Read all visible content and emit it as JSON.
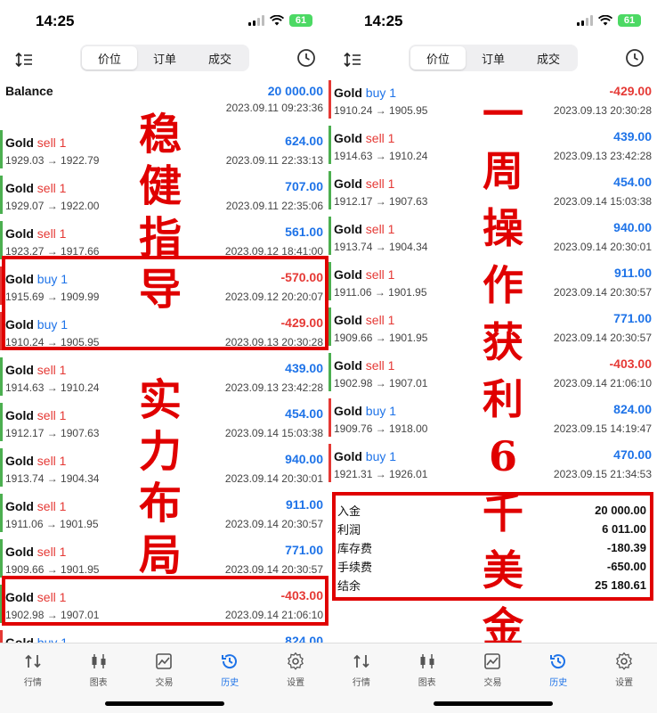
{
  "colors": {
    "profit_positive": "#1e73e8",
    "profit_negative": "#e53935",
    "sell": "#e53935",
    "buy": "#1e73e8",
    "annotation": "#e00000",
    "indicator_sell": "#4caf50",
    "indicator_buy": "#e53935"
  },
  "left": {
    "status": {
      "time": "14:25",
      "battery": "61"
    },
    "toolbar": {
      "tabs": [
        "价位",
        "订单",
        "成交"
      ],
      "active_tab": "价位"
    },
    "balance": {
      "label": "Balance",
      "amount": "20 000.00",
      "time": "2023.09.11 09:23:36"
    },
    "trades": [
      {
        "symbol": "Gold",
        "side": "sell 1",
        "prices": "1929.03 → 1922.79",
        "profit": "624.00",
        "time": "2023.09.11 22:33:13"
      },
      {
        "symbol": "Gold",
        "side": "sell 1",
        "prices": "1929.07 → 1922.00",
        "profit": "707.00",
        "time": "2023.09.11 22:35:06"
      },
      {
        "symbol": "Gold",
        "side": "sell 1",
        "prices": "1923.27 → 1917.66",
        "profit": "561.00",
        "time": "2023.09.12 18:41:00"
      },
      {
        "symbol": "Gold",
        "side": "buy 1",
        "prices": "1915.69 → 1909.99",
        "profit": "-570.00",
        "time": "2023.09.12 20:20:07"
      },
      {
        "symbol": "Gold",
        "side": "buy 1",
        "prices": "1910.24 → 1905.95",
        "profit": "-429.00",
        "time": "2023.09.13 20:30:28"
      },
      {
        "symbol": "Gold",
        "side": "sell 1",
        "prices": "1914.63 → 1910.24",
        "profit": "439.00",
        "time": "2023.09.13 23:42:28"
      },
      {
        "symbol": "Gold",
        "side": "sell 1",
        "prices": "1912.17 → 1907.63",
        "profit": "454.00",
        "time": "2023.09.14 15:03:38"
      },
      {
        "symbol": "Gold",
        "side": "sell 1",
        "prices": "1913.74 → 1904.34",
        "profit": "940.00",
        "time": "2023.09.14 20:30:01"
      },
      {
        "symbol": "Gold",
        "side": "sell 1",
        "prices": "1911.06 → 1901.95",
        "profit": "911.00",
        "time": "2023.09.14 20:30:57"
      },
      {
        "symbol": "Gold",
        "side": "sell 1",
        "prices": "1909.66 → 1901.95",
        "profit": "771.00",
        "time": "2023.09.14 20:30:57"
      },
      {
        "symbol": "Gold",
        "side": "sell 1",
        "prices": "1902.98 → 1907.01",
        "profit": "-403.00",
        "time": "2023.09.14 21:06:10"
      },
      {
        "symbol": "Gold",
        "side": "buy 1",
        "prices": "",
        "profit": "824.00",
        "time": ""
      }
    ],
    "annotation_top": "稳健指导",
    "annotation_bottom": "实力布局"
  },
  "right": {
    "status": {
      "time": "14:25",
      "battery": "61"
    },
    "toolbar": {
      "tabs": [
        "价位",
        "订单",
        "成交"
      ],
      "active_tab": "价位"
    },
    "trades": [
      {
        "symbol": "Gold",
        "side": "buy 1",
        "prices": "1910.24 → 1905.95",
        "profit": "-429.00",
        "time": "2023.09.13 20:30:28"
      },
      {
        "symbol": "Gold",
        "side": "sell 1",
        "prices": "1914.63 → 1910.24",
        "profit": "439.00",
        "time": "2023.09.13 23:42:28"
      },
      {
        "symbol": "Gold",
        "side": "sell 1",
        "prices": "1912.17 → 1907.63",
        "profit": "454.00",
        "time": "2023.09.14 15:03:38"
      },
      {
        "symbol": "Gold",
        "side": "sell 1",
        "prices": "1913.74 → 1904.34",
        "profit": "940.00",
        "time": "2023.09.14 20:30:01"
      },
      {
        "symbol": "Gold",
        "side": "sell 1",
        "prices": "1911.06 → 1901.95",
        "profit": "911.00",
        "time": "2023.09.14 20:30:57"
      },
      {
        "symbol": "Gold",
        "side": "sell 1",
        "prices": "1909.66 → 1901.95",
        "profit": "771.00",
        "time": "2023.09.14 20:30:57"
      },
      {
        "symbol": "Gold",
        "side": "sell 1",
        "prices": "1902.98 → 1907.01",
        "profit": "-403.00",
        "time": "2023.09.14 21:06:10"
      },
      {
        "symbol": "Gold",
        "side": "buy 1",
        "prices": "1909.76 → 1918.00",
        "profit": "824.00",
        "time": "2023.09.15 14:19:47"
      },
      {
        "symbol": "Gold",
        "side": "buy 1",
        "prices": "1921.31 → 1926.01",
        "profit": "470.00",
        "time": "2023.09.15 21:34:53"
      }
    ],
    "summary": [
      {
        "label": "入金",
        "value": "20 000.00"
      },
      {
        "label": "利润",
        "value": "6 011.00"
      },
      {
        "label": "库存费",
        "value": "-180.39"
      },
      {
        "label": "手续费",
        "value": "-650.00"
      },
      {
        "label": "结余",
        "value": "25 180.61"
      }
    ],
    "annotation": "一周操作获利6千美金"
  },
  "tabbar": {
    "items": [
      {
        "label": "行情",
        "icon": "quotes-icon"
      },
      {
        "label": "图表",
        "icon": "chart-icon"
      },
      {
        "label": "交易",
        "icon": "trade-icon"
      },
      {
        "label": "历史",
        "icon": "history-icon"
      },
      {
        "label": "设置",
        "icon": "settings-icon"
      }
    ],
    "active": "历史"
  }
}
